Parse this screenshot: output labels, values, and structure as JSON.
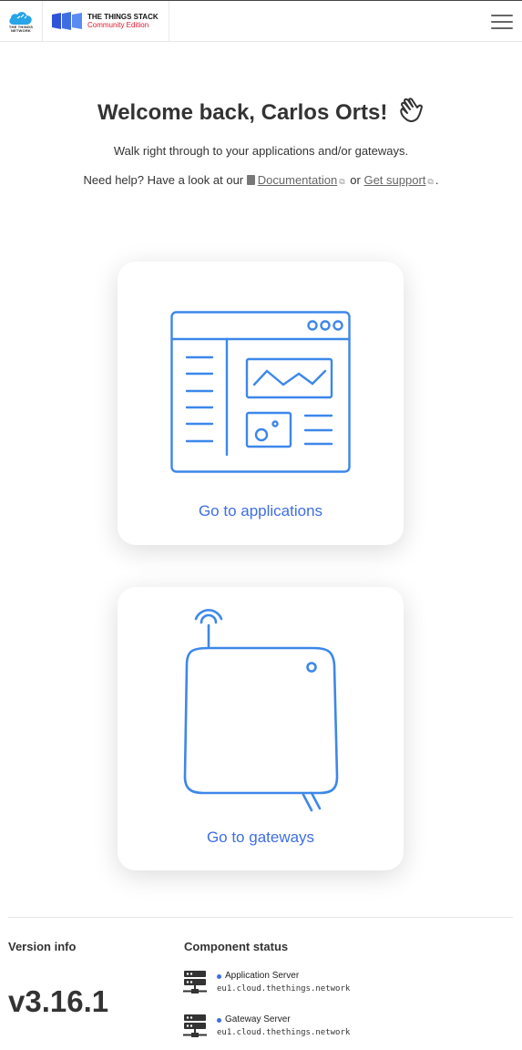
{
  "header": {
    "ttn_logo_text": "THE THINGS NETWORK",
    "stack_title": "THE THINGS STACK",
    "stack_edition": "Community Edition",
    "menu_icon": "hamburger-icon"
  },
  "welcome": {
    "title": "Welcome back, Carlos Orts!",
    "wave_icon": "waving-hand-icon",
    "intro": "Walk right through to your applications and/or gateways.",
    "help_prefix": "Need help? Have a look at our",
    "doc_link": "Documentation",
    "help_or": "or",
    "support_link": "Get support",
    "help_suffix": "."
  },
  "cards": {
    "applications": {
      "label": "Go to applications",
      "icon": "application-dashboard-icon"
    },
    "gateways": {
      "label": "Go to gateways",
      "icon": "gateway-device-icon"
    }
  },
  "footer": {
    "version_label": "Version info",
    "version_value": "v3.16.1",
    "component_label": "Component status",
    "components": [
      {
        "name": "Application Server",
        "host": "eu1.cloud.thethings.network",
        "icon": "server-icon"
      },
      {
        "name": "Gateway Server",
        "host": "eu1.cloud.thethings.network",
        "icon": "server-icon"
      }
    ]
  },
  "colors": {
    "accent": "#3f6ee3",
    "illustration": "#3d87ea",
    "edition_red": "#e0172f"
  }
}
